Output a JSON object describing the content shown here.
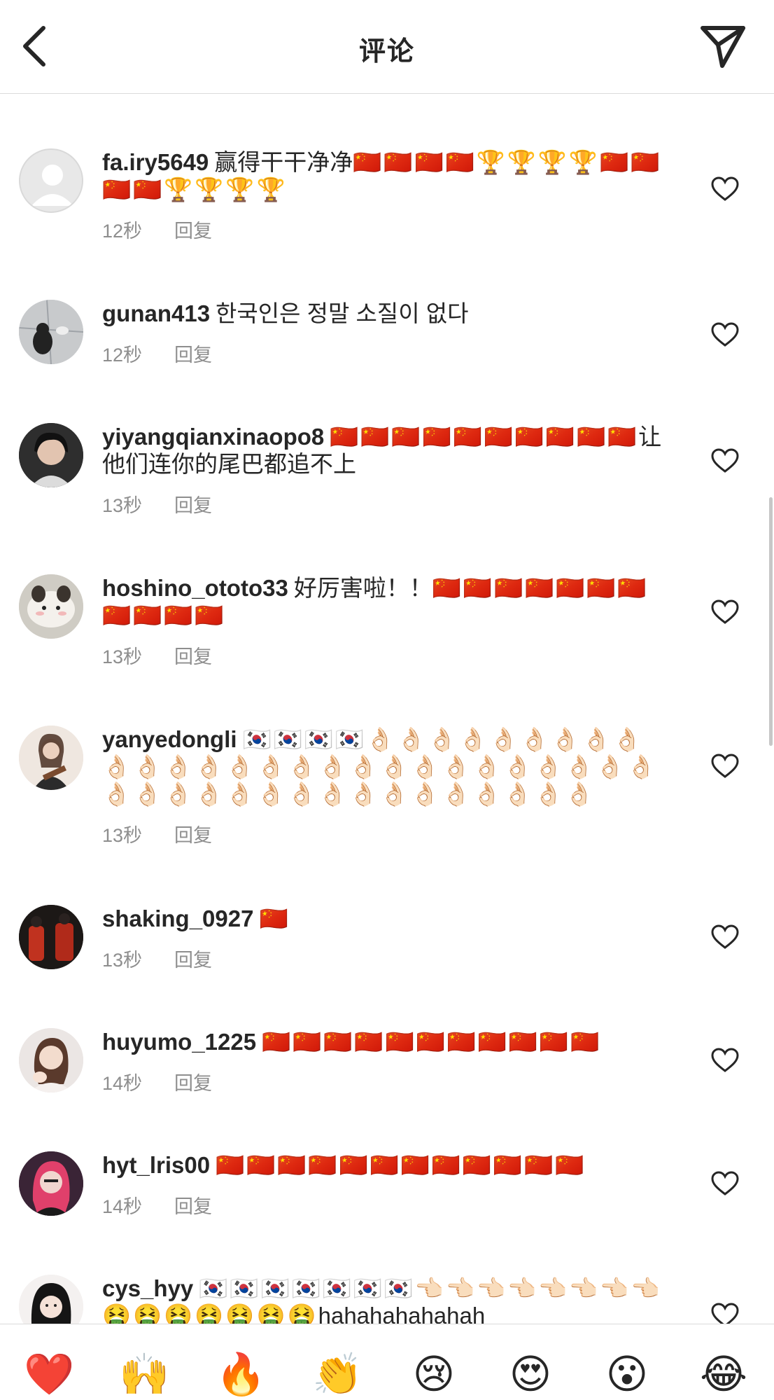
{
  "header": {
    "title": "评论"
  },
  "comments": [
    {
      "username": "fa.iry5649",
      "text": "赢得干干净净",
      "emojis": "🇨🇳🇨🇳🇨🇳🇨🇳🏆🏆🏆🏆🇨🇳🇨🇳🇨🇳🇨🇳🏆🏆🏆🏆",
      "time": "12秒",
      "reply": "回复"
    },
    {
      "username": "gunan413",
      "text": "한국인은 정말 소질이 없다",
      "emojis": "",
      "time": "12秒",
      "reply": "回复"
    },
    {
      "username": "yiyangqianxinaopo8",
      "text": "",
      "emojis": "🇨🇳🇨🇳🇨🇳🇨🇳🇨🇳🇨🇳🇨🇳🇨🇳🇨🇳🇨🇳",
      "text2": "让他们连你的尾巴都追不上",
      "time": "13秒",
      "reply": "回复"
    },
    {
      "username": "hoshino_ototo33",
      "text": "好厉害啦！！",
      "emojis": "🇨🇳🇨🇳🇨🇳🇨🇳🇨🇳🇨🇳🇨🇳🇨🇳🇨🇳🇨🇳🇨🇳",
      "time": "13秒",
      "reply": "回复"
    },
    {
      "username": "yanyedongli",
      "text": "",
      "emojis": "🇰🇷🇰🇷🇰🇷🇰🇷👌🏻👌🏻👌🏻👌🏻👌🏻👌🏻👌🏻👌🏻👌🏻👌🏻👌🏻👌🏻👌🏻👌🏻👌🏻👌🏻👌🏻👌🏻👌🏻👌🏻👌🏻👌🏻👌🏻👌🏻👌🏻👌🏻👌🏻👌🏻👌🏻👌🏻👌🏻👌🏻👌🏻👌🏻👌🏻👌🏻👌🏻👌🏻👌🏻👌🏻👌🏻👌🏻👌🏻",
      "time": "13秒",
      "reply": "回复"
    },
    {
      "username": "shaking_0927",
      "text": "",
      "emojis": "🇨🇳",
      "time": "13秒",
      "reply": "回复"
    },
    {
      "username": "huyumo_1225",
      "text": "",
      "emojis": "🇨🇳🇨🇳🇨🇳🇨🇳🇨🇳🇨🇳🇨🇳🇨🇳🇨🇳🇨🇳🇨🇳",
      "time": "14秒",
      "reply": "回复"
    },
    {
      "username": "hyt_lris00",
      "text": "",
      "emojis": "🇨🇳🇨🇳🇨🇳🇨🇳🇨🇳🇨🇳🇨🇳🇨🇳🇨🇳🇨🇳🇨🇳🇨🇳",
      "time": "14秒",
      "reply": "回复"
    },
    {
      "username": "cys_hyy",
      "text": "",
      "emojis": "🇰🇷🇰🇷🇰🇷🇰🇷🇰🇷🇰🇷🇰🇷👈🏻👈🏻👈🏻👈🏻👈🏻👈🏻👈🏻👈🏻🤮🤮🤮🤮🤮🤮🤮",
      "text2": "hahahahahahah",
      "time": "",
      "reply": ""
    }
  ],
  "reactions": [
    "❤️",
    "🙌",
    "🔥",
    "👏",
    "😢",
    "😍",
    "😮",
    "😂"
  ],
  "colors": {
    "text": "#262626",
    "meta": "#8e8e8e",
    "divider": "#dbdbdb"
  }
}
